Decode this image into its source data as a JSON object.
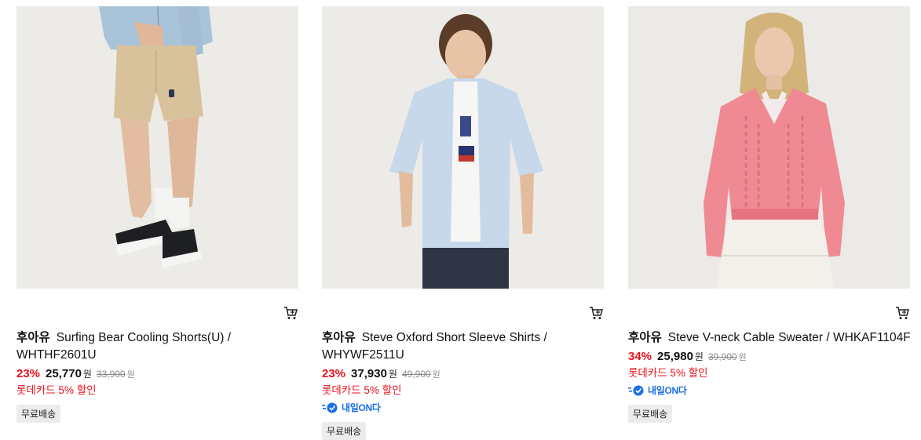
{
  "products": [
    {
      "brand": "후아유",
      "name": "Surfing Bear Cooling Shorts(U) / WHTHF2601U",
      "discount": "23%",
      "price": "25,770",
      "currency": "원",
      "original_price": "33,900",
      "card_promo": "롯데카드 5% 할인",
      "delivery_badge": "",
      "shipping_badge": "무료배송",
      "image_icon": "shorts-model-photo"
    },
    {
      "brand": "후아유",
      "name": "Steve Oxford Short Sleeve Shirts / WHYWF2511U",
      "discount": "23%",
      "price": "37,930",
      "currency": "원",
      "original_price": "49,900",
      "card_promo": "롯데카드 5% 할인",
      "delivery_badge": "내일ON다",
      "shipping_badge": "무료배송",
      "image_icon": "shirt-model-photo"
    },
    {
      "brand": "후아유",
      "name": "Steve V-neck Cable Sweater / WHKAF1104F",
      "discount": "34%",
      "price": "25,980",
      "currency": "원",
      "original_price": "39,900",
      "card_promo": "롯데카드 5% 할인",
      "delivery_badge": "내일ON다",
      "shipping_badge": "무료배송",
      "image_icon": "sweater-model-photo"
    }
  ],
  "colors": {
    "discount": "#e8111c",
    "delivery": "#1a6fe8",
    "photo_bg": "#ededeb"
  },
  "icons": {
    "cart": "cart-icon",
    "delivery": "truck-icon"
  }
}
